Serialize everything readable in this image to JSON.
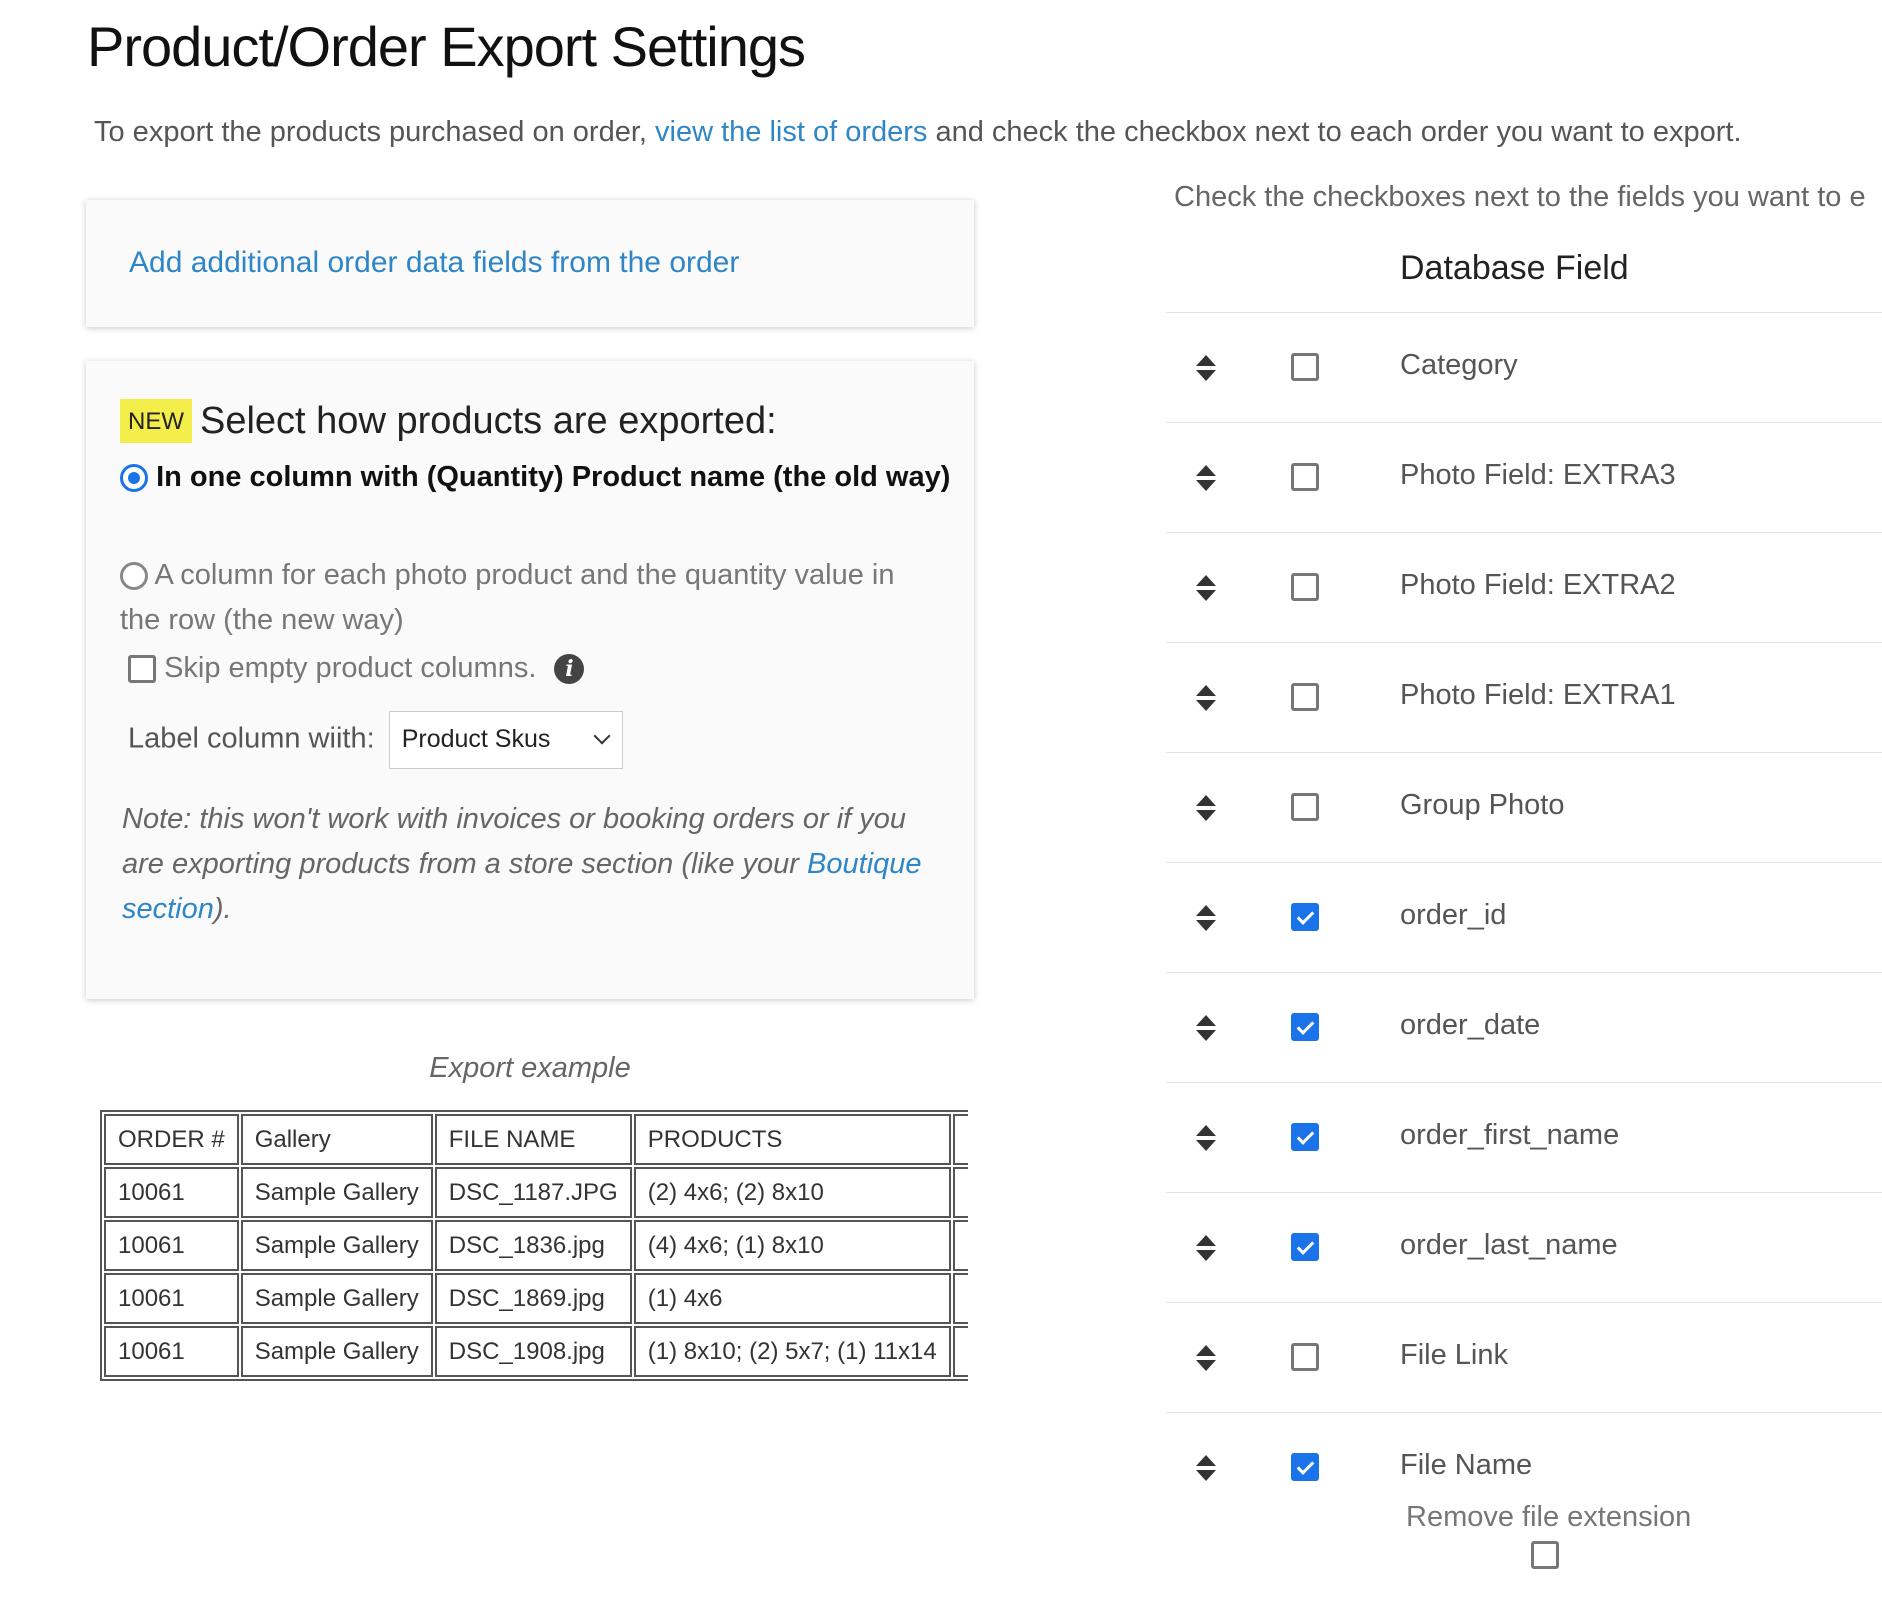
{
  "page": {
    "title": "Product/Order Export Settings",
    "intro_before": "To export the products purchased on order, ",
    "intro_link": "view the list of orders",
    "intro_after": " and check the checkbox next to each order you want to export."
  },
  "colors": {
    "link": "#2f86c6",
    "accent": "#1a73e8",
    "badge": "#f4ee4a"
  },
  "additional_fields": {
    "link_label": "Add additional order data fields from the order"
  },
  "export_mode": {
    "badge": "NEW",
    "heading": "Select how products are exported:",
    "options": [
      {
        "label": "In one column with (Quantity) Product name (the old way)",
        "selected": true
      },
      {
        "label": "A column for each photo product and the quantity value in the row (the new way)",
        "selected": false
      }
    ],
    "skip_empty_label": "Skip empty product columns.",
    "skip_empty_checked": false,
    "info_icon_glyph": "i",
    "label_column_label": "Label column wiith:",
    "label_column_value": "Product Skus",
    "note_before": "Note: this won't work with invoices or booking orders or if you are exporting products from a store section (like your ",
    "note_link": "Boutique section",
    "note_after": ")."
  },
  "example": {
    "caption": "Export example",
    "columns": [
      "ORDER #",
      "Gallery",
      "FILE NAME",
      "PRODUCTS"
    ],
    "rows": [
      [
        "10061",
        "Sample Gallery",
        "DSC_1187.JPG",
        "(2) 4x6; (2) 8x10"
      ],
      [
        "10061",
        "Sample Gallery",
        "DSC_1836.jpg",
        "(4) 4x6; (1) 8x10"
      ],
      [
        "10061",
        "Sample Gallery",
        "DSC_1869.jpg",
        "(1) 4x6"
      ],
      [
        "10061",
        "Sample Gallery",
        "DSC_1908.jpg",
        "(1) 8x10; (2) 5x7; (1) 11x14"
      ]
    ]
  },
  "fields": {
    "intro": "Check the checkboxes next to the fields you want to e",
    "header": "Database Field",
    "rows": [
      {
        "label": "Category",
        "checked": false
      },
      {
        "label": "Photo Field: EXTRA3",
        "checked": false
      },
      {
        "label": "Photo Field: EXTRA2",
        "checked": false
      },
      {
        "label": "Photo Field: EXTRA1",
        "checked": false
      },
      {
        "label": "Group Photo",
        "checked": false
      },
      {
        "label": "order_id",
        "checked": true
      },
      {
        "label": "order_date",
        "checked": true
      },
      {
        "label": "order_first_name",
        "checked": true
      },
      {
        "label": "order_last_name",
        "checked": true
      },
      {
        "label": "File Link",
        "checked": false
      },
      {
        "label": "File Name",
        "checked": true
      }
    ],
    "remove_extension_label": "Remove file extension",
    "remove_extension_checked": false
  }
}
